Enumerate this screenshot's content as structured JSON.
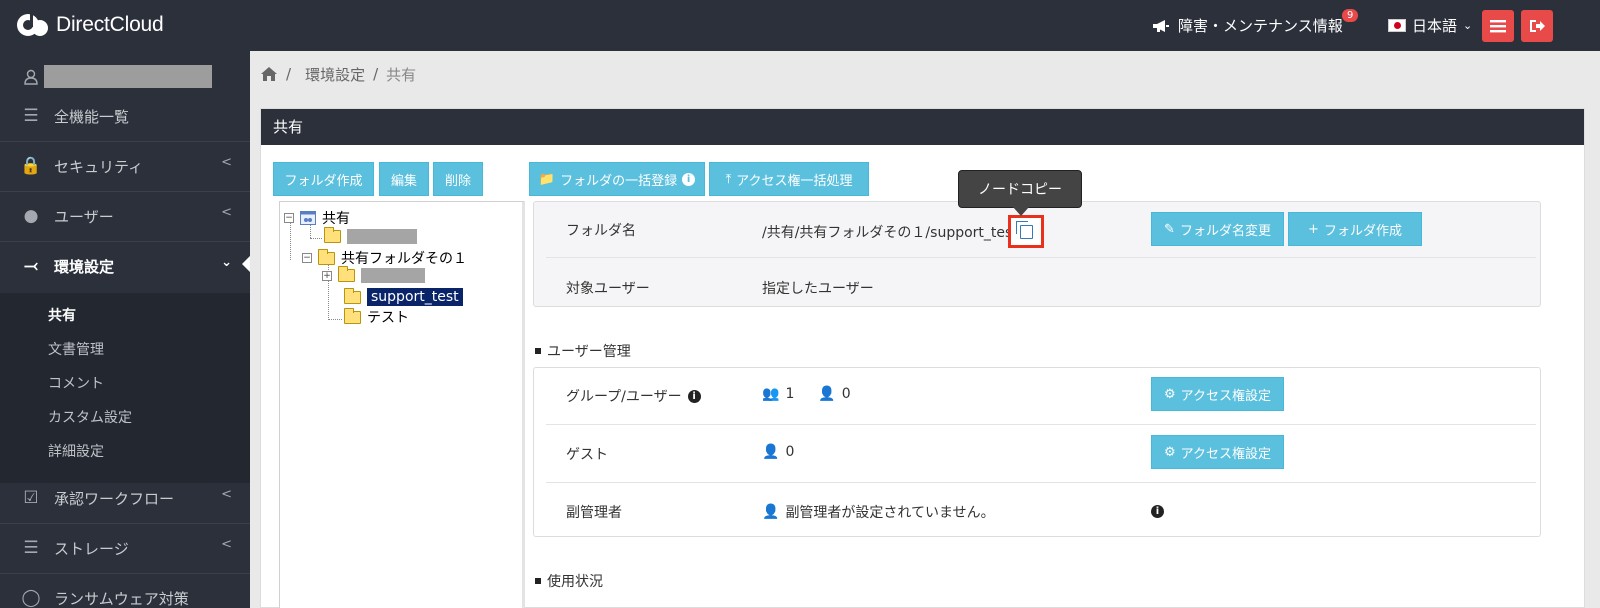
{
  "app": {
    "brand": "DirectCloud"
  },
  "topbar": {
    "notice_label": "障害・メンテナンス情報",
    "notice_count": "9",
    "language": "日本語"
  },
  "sidebar": {
    "items": [
      {
        "label": "全機能一覧",
        "icon": "list-icon"
      },
      {
        "label": "セキュリティ",
        "icon": "lock-icon"
      },
      {
        "label": "ユーザー",
        "icon": "user-icon"
      },
      {
        "label": "環境設定",
        "icon": "share-icon"
      },
      {
        "label": "承認ワークフロー",
        "icon": "checkbox-icon"
      },
      {
        "label": "ストレージ",
        "icon": "database-icon"
      },
      {
        "label": "ランサムウェア対策",
        "icon": "shield-icon"
      }
    ],
    "sub_items": [
      "共有",
      "文書管理",
      "コメント",
      "カスタム設定",
      "詳細設定"
    ]
  },
  "breadcrumb": {
    "items": [
      "環境設定",
      "共有"
    ]
  },
  "panel": {
    "title": "共有",
    "tree_buttons": {
      "create": "フォルダ作成",
      "edit": "編集",
      "delete": "削除"
    },
    "bulk_buttons": {
      "register": "フォルダの一括登録",
      "access": "アクセス権一括処理"
    },
    "tree": {
      "root": "共有",
      "folder_1": "共有フォルダその１",
      "selected": "support_test",
      "test": "テスト"
    },
    "folder_info": {
      "name_label": "フォルダ名",
      "path": "/共有/共有フォルダその１/support_test/",
      "tooltip": "ノードコピー",
      "rename_button": "フォルダ名変更",
      "create_button": "フォルダ作成",
      "target_label": "対象ユーザー",
      "target_value": "指定したユーザー"
    },
    "user_mgmt": {
      "title": "ユーザー管理",
      "group_label": "グループ/ユーザー",
      "group_count": "1",
      "user_count": "0",
      "guest_label": "ゲスト",
      "guest_count": "0",
      "access_button": "アクセス権設定",
      "admin_label": "副管理者",
      "admin_value": "副管理者が設定されていません。"
    },
    "usage": {
      "title": "使用状況"
    }
  }
}
